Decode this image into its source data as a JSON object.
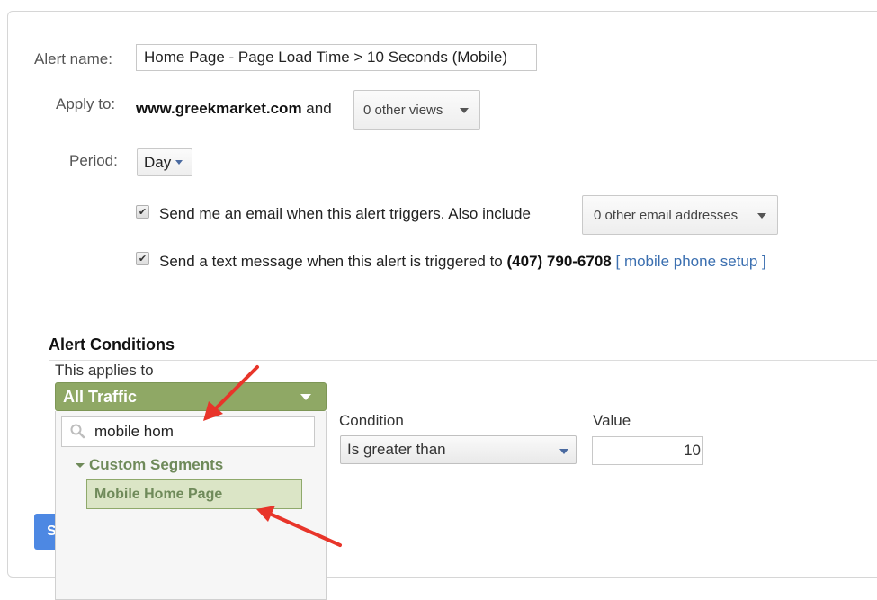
{
  "form": {
    "alert_name_label": "Alert name:",
    "alert_name_value": "Home Page - Page Load Time > 10 Seconds (Mobile)",
    "apply_to_label": "Apply to:",
    "apply_to_view": "www.greekmarket.com",
    "apply_to_and": "and",
    "other_views_dropdown": "0 other views",
    "period_label": "Period:",
    "period_value": "Day",
    "email_checkbox": {
      "checked": true,
      "text": "Send me an email when this alert triggers. Also include"
    },
    "other_emails_dropdown": "0 other email addresses",
    "sms_checkbox": {
      "checked": true,
      "text": "Send a text message when this alert is triggered to",
      "phone": "(407) 790-6708",
      "link": "[ mobile phone setup ]"
    }
  },
  "conditions": {
    "title": "Alert Conditions",
    "applies_to_label": "This applies to",
    "segment_selected": "All Traffic",
    "segment_search_value": "mobile hom",
    "segment_group": "Custom Segments",
    "segment_result": "Mobile Home Page",
    "condition_label": "Condition",
    "condition_value": "Is greater than",
    "value_label": "Value",
    "value_value": "10"
  },
  "actions": {
    "save_label_partial": "S"
  },
  "annotations": {
    "arrow_color": "#e8352a",
    "segment_color": "#8fa865",
    "link_color": "#3b6fb0",
    "save_color": "#4d88e3"
  }
}
